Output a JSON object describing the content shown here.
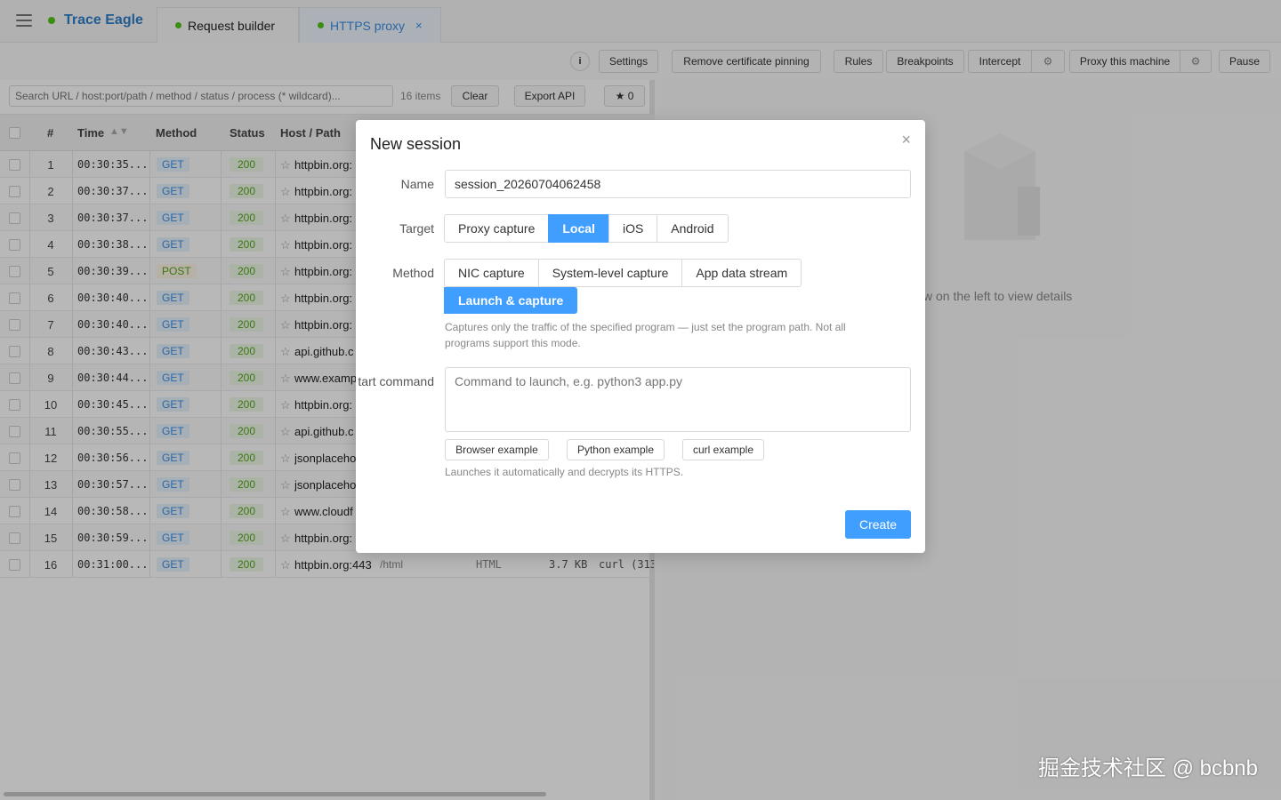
{
  "app": {
    "brand": "Trace Eagle"
  },
  "tabs": [
    {
      "label": "Request builder"
    },
    {
      "label": "HTTPS proxy",
      "close": "×"
    }
  ],
  "toolbar": {
    "info": "i",
    "settings": "Settings",
    "remove_pinning": "Remove certificate pinning",
    "rules": "Rules",
    "breakpoints": "Breakpoints",
    "intercept": "Intercept",
    "gear": "⚙",
    "proxy_machine": "Proxy this machine",
    "pause": "Pause"
  },
  "list": {
    "search_placeholder": "Search URL / host:port/path / method / status / process (* wildcard)...",
    "count": "16 items",
    "clear": "Clear",
    "export": "Export API",
    "star_count": "★ 0",
    "headers": {
      "num": "#",
      "time": "Time",
      "method": "Method",
      "status": "Status",
      "host": "Host / Path"
    },
    "rows": [
      {
        "num": "1",
        "time": "00:30:35....",
        "method": "GET",
        "status": "200",
        "host": "httpbin.org:"
      },
      {
        "num": "2",
        "time": "00:30:37....",
        "method": "GET",
        "status": "200",
        "host": "httpbin.org:"
      },
      {
        "num": "3",
        "time": "00:30:37....",
        "method": "GET",
        "status": "200",
        "host": "httpbin.org:"
      },
      {
        "num": "4",
        "time": "00:30:38....",
        "method": "GET",
        "status": "200",
        "host": "httpbin.org:"
      },
      {
        "num": "5",
        "time": "00:30:39....",
        "method": "POST",
        "status": "200",
        "host": "httpbin.org:"
      },
      {
        "num": "6",
        "time": "00:30:40....",
        "method": "GET",
        "status": "200",
        "host": "httpbin.org:"
      },
      {
        "num": "7",
        "time": "00:30:40....",
        "method": "GET",
        "status": "200",
        "host": "httpbin.org:"
      },
      {
        "num": "8",
        "time": "00:30:43....",
        "method": "GET",
        "status": "200",
        "host": "api.github.c"
      },
      {
        "num": "9",
        "time": "00:30:44....",
        "method": "GET",
        "status": "200",
        "host": "www.exampl"
      },
      {
        "num": "10",
        "time": "00:30:45....",
        "method": "GET",
        "status": "200",
        "host": "httpbin.org:"
      },
      {
        "num": "11",
        "time": "00:30:55....",
        "method": "GET",
        "status": "200",
        "host": "api.github.c"
      },
      {
        "num": "12",
        "time": "00:30:56....",
        "method": "GET",
        "status": "200",
        "host": "jsonplaceho"
      },
      {
        "num": "13",
        "time": "00:30:57....",
        "method": "GET",
        "status": "200",
        "host": "jsonplaceho"
      },
      {
        "num": "14",
        "time": "00:30:58....",
        "method": "GET",
        "status": "200",
        "host": "www.cloudf"
      },
      {
        "num": "15",
        "time": "00:30:59....",
        "method": "GET",
        "status": "200",
        "host": "httpbin.org:"
      },
      {
        "num": "16",
        "time": "00:31:00....",
        "method": "GET",
        "status": "200",
        "host": "httpbin.org:443",
        "path": "/html",
        "type": "HTML",
        "size": "3.7 KB",
        "process": "curl (313"
      }
    ]
  },
  "detail": {
    "empty_hint": "w on the left to view details"
  },
  "modal": {
    "title": "New session",
    "close": "×",
    "name_label": "Name",
    "name_value": "session_20260704062458",
    "target_label": "Target",
    "targets": [
      "Proxy capture",
      "Local",
      "iOS",
      "Android"
    ],
    "target_active": "Local",
    "method_label": "Method",
    "methods": [
      "NIC capture",
      "System-level capture",
      "App data stream"
    ],
    "method_active": "Launch & capture",
    "method_hint": "Captures only the traffic of the specified program — just set the program path. Not all programs support this mode.",
    "command_label": "tart command",
    "command_placeholder": "Command to launch, e.g. python3 app.py",
    "examples": [
      "Browser example",
      "Python example",
      "curl example"
    ],
    "command_hint": "Launches it automatically and decrypts its HTTPS.",
    "create": "Create"
  },
  "watermark": "掘金技术社区 @ bcbnb"
}
